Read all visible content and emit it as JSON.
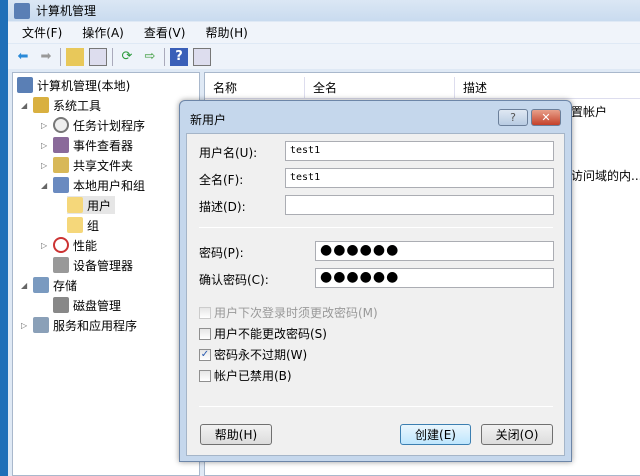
{
  "window": {
    "title": "计算机管理"
  },
  "menu": [
    "文件(F)",
    "操作(A)",
    "查看(V)",
    "帮助(H)"
  ],
  "tree": [
    {
      "label": "计算机管理(本地)"
    },
    {
      "label": "系统工具"
    },
    {
      "label": "任务计划程序"
    },
    {
      "label": "事件查看器"
    },
    {
      "label": "共享文件夹"
    },
    {
      "label": "本地用户和组"
    },
    {
      "label": "用户"
    },
    {
      "label": "组"
    },
    {
      "label": "性能"
    },
    {
      "label": "设备管理器"
    },
    {
      "label": "存储"
    },
    {
      "label": "磁盘管理"
    },
    {
      "label": "服务和应用程序"
    }
  ],
  "columns": [
    "名称",
    "全名",
    "描述"
  ],
  "rows_visible": [
    "置帐户",
    "访问域的内..."
  ],
  "dialog": {
    "title": "新用户",
    "help_glyph": "?",
    "close_glyph": "✕",
    "username_label": "用户名(U):",
    "username": "test1",
    "fullname_label": "全名(F):",
    "fullname": "test1",
    "desc_label": "描述(D):",
    "desc": "",
    "password_label": "密码(P):",
    "password": "●●●●●●",
    "confirm_label": "确认密码(C):",
    "confirm": "●●●●●●",
    "checkboxes": [
      {
        "label": "用户下次登录时须更改密码(M)",
        "checked": false,
        "disabled": true,
        "mark": ""
      },
      {
        "label": "用户不能更改密码(S)",
        "checked": false,
        "disabled": false,
        "mark": ""
      },
      {
        "label": "密码永不过期(W)",
        "checked": true,
        "disabled": false,
        "mark": "✓"
      },
      {
        "label": "帐户已禁用(B)",
        "checked": false,
        "disabled": false,
        "mark": ""
      }
    ],
    "help_button": "帮助(H)",
    "create_button": "创建(E)",
    "close_button": "关闭(O)"
  }
}
